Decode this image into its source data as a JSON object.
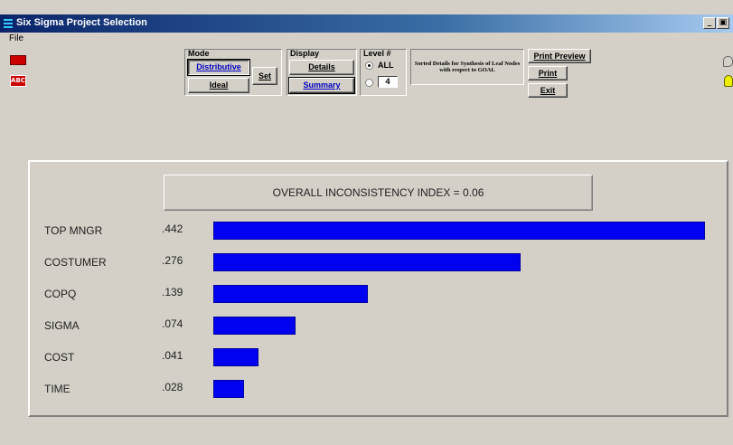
{
  "window": {
    "title": "Six Sigma Project Selection"
  },
  "menu": {
    "file": "File"
  },
  "left_icons": {
    "abc": "ABC"
  },
  "mode": {
    "label": "Mode",
    "distributive": "Distributive",
    "ideal": "Ideal",
    "set": "Set"
  },
  "display": {
    "label": "Display",
    "details": "Details",
    "summary": "Summary"
  },
  "level": {
    "label": "Level #",
    "all": "ALL",
    "value": "4",
    "selected": "ALL"
  },
  "sorted_details": "Sorted Details for Synthesis of Leaf Nodes with respect to GOAL",
  "actions": {
    "print_preview": "Print Preview",
    "print": "Print",
    "exit": "Exit"
  },
  "result": {
    "inconsistency": "OVERALL INCONSISTENCY INDEX =  0.06",
    "rows": [
      {
        "label": "TOP MNGR",
        "value_text": ".442",
        "value": 0.442
      },
      {
        "label": "COSTUMER",
        "value_text": ".276",
        "value": 0.276
      },
      {
        "label": "COPQ",
        "value_text": ".139",
        "value": 0.139
      },
      {
        "label": "SIGMA",
        "value_text": ".074",
        "value": 0.074
      },
      {
        "label": "COST",
        "value_text": ".041",
        "value": 0.041
      },
      {
        "label": "TIME",
        "value_text": ".028",
        "value": 0.028
      }
    ]
  },
  "colors": {
    "bar": "#0000f0",
    "titlebar": "#0a246a",
    "face": "#d4d0c8"
  }
}
